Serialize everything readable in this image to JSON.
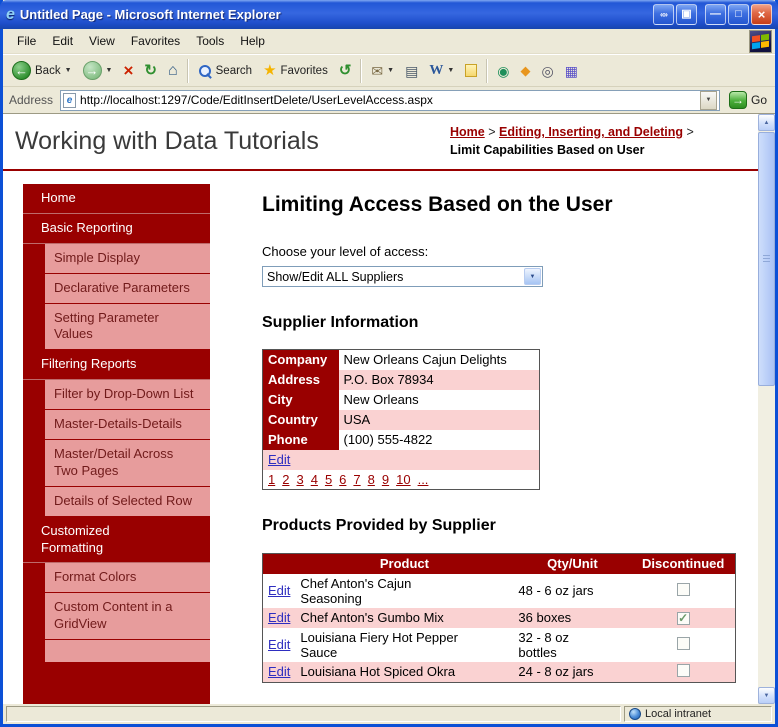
{
  "window": {
    "title": "Untitled Page - Microsoft Internet Explorer"
  },
  "menu": {
    "items": [
      "File",
      "Edit",
      "View",
      "Favorites",
      "Tools",
      "Help"
    ]
  },
  "toolbar": {
    "back": "Back",
    "search": "Search",
    "favorites": "Favorites"
  },
  "address": {
    "label": "Address",
    "url": "http://localhost:1297/Code/EditInsertDelete/UserLevelAccess.aspx",
    "go": "Go"
  },
  "icons": {
    "ie_logo": "e",
    "chevrons": "«»",
    "extra_window": "▣",
    "minimize": "—",
    "maximize": "□",
    "close": "×",
    "back_arrow": "←",
    "forward_arrow": "→",
    "stop": "×",
    "refresh": "↻",
    "home": "⌂",
    "favorites_star": "★",
    "history": "↺",
    "mail": "✉",
    "print": "▤",
    "edit_word": "W",
    "dropdown": "▼",
    "go_arrow": "→",
    "scroll_up": "▲",
    "scroll_down": "▼",
    "addon_globe": "◉",
    "addon_spark": "◆",
    "addon_research": "◎",
    "addon_grid": "▦",
    "page_icon": "e",
    "check": "✓"
  },
  "colors": {
    "accent_dark_red": "#990000",
    "sidebar_pink": "#E79C9C",
    "table_pink": "#FAD2D2",
    "edit_link_blue": "#2E2EC0"
  },
  "page": {
    "site_title": "Working with Data Tutorials",
    "breadcrumb": {
      "home": "Home",
      "separator": ">",
      "section": "Editing, Inserting, and Deleting",
      "current": "Limit Capabilities Based on User"
    },
    "sidebar": {
      "items": [
        {
          "label": "Home",
          "type": "section"
        },
        {
          "label": "Basic Reporting",
          "type": "section"
        },
        {
          "label": "Simple Display",
          "type": "sub"
        },
        {
          "label": "Declarative Parameters",
          "type": "sub"
        },
        {
          "label": "Setting Parameter Values",
          "type": "sub"
        },
        {
          "label": "Filtering Reports",
          "type": "section"
        },
        {
          "label": "Filter by Drop-Down List",
          "type": "sub"
        },
        {
          "label": "Master-Details-Details",
          "type": "sub"
        },
        {
          "label": "Master/Detail Across Two Pages",
          "type": "sub"
        },
        {
          "label": "Details of Selected Row",
          "type": "sub"
        },
        {
          "label": "Customized Formatting",
          "type": "section"
        },
        {
          "label": "Format Colors",
          "type": "sub"
        },
        {
          "label": "Custom Content in a GridView",
          "type": "sub"
        }
      ]
    },
    "main": {
      "title": "Limiting Access Based on the User",
      "access_label": "Choose your level of access:",
      "access_dropdown": {
        "selected": "Show/Edit ALL Suppliers"
      },
      "supplier_heading": "Supplier Information",
      "supplier_table": {
        "rows": [
          {
            "label": "Company",
            "value": "New Orleans Cajun Delights"
          },
          {
            "label": "Address",
            "value": "P.O. Box 78934"
          },
          {
            "label": "City",
            "value": "New Orleans"
          },
          {
            "label": "Country",
            "value": "USA"
          },
          {
            "label": "Phone",
            "value": "(100) 555-4822"
          }
        ],
        "edit_label": "Edit",
        "pager": [
          "1",
          "2",
          "3",
          "4",
          "5",
          "6",
          "7",
          "8",
          "9",
          "10",
          "..."
        ]
      },
      "products_heading": "Products Provided by Supplier",
      "products_table": {
        "headers": {
          "product": "Product",
          "qty": "Qty/Unit",
          "discontinued": "Discontinued"
        },
        "edit_label": "Edit",
        "rows": [
          {
            "product": "Chef Anton's Cajun Seasoning",
            "qty": "48 - 6 oz jars",
            "discontinued": false
          },
          {
            "product": "Chef Anton's Gumbo Mix",
            "qty": "36 boxes",
            "discontinued": true
          },
          {
            "product": "Louisiana Fiery Hot Pepper Sauce",
            "qty": "32 - 8 oz bottles",
            "discontinued": false
          },
          {
            "product": "Louisiana Hot Spiced Okra",
            "qty": "24 - 8 oz jars",
            "discontinued": false
          }
        ]
      }
    }
  },
  "statusbar": {
    "zone": "Local intranet"
  }
}
